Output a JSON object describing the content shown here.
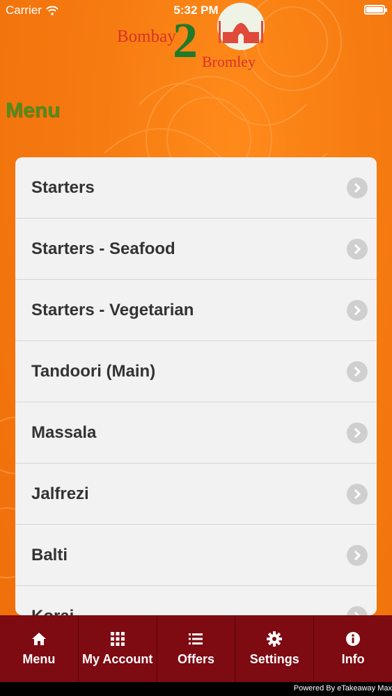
{
  "status_bar": {
    "carrier": "Carrier",
    "time": "5:32 PM",
    "battery_level": 1.0
  },
  "logo": {
    "word1": "Bombay",
    "numeral": "2",
    "word2": "Bromley"
  },
  "page": {
    "title": "Menu"
  },
  "menu": {
    "items": [
      {
        "label": "Starters"
      },
      {
        "label": "Starters - Seafood"
      },
      {
        "label": "Starters - Vegetarian"
      },
      {
        "label": "Tandoori (Main)"
      },
      {
        "label": "Massala"
      },
      {
        "label": "Jalfrezi"
      },
      {
        "label": "Balti"
      },
      {
        "label": "Korai"
      }
    ]
  },
  "tab_bar": {
    "tabs": [
      {
        "label": "Menu",
        "icon": "home-icon"
      },
      {
        "label": "My Account",
        "icon": "grid-icon"
      },
      {
        "label": "Offers",
        "icon": "list-icon"
      },
      {
        "label": "Settings",
        "icon": "gear-icon"
      },
      {
        "label": "Info",
        "icon": "info-icon"
      }
    ]
  },
  "footer": {
    "powered_by": "Powered By eTakeaway Max"
  },
  "colors": {
    "background": "#f57a10",
    "title_green": "#4a8f1c",
    "tab_bar": "#7e0a12",
    "card": "#f2f2f2"
  }
}
